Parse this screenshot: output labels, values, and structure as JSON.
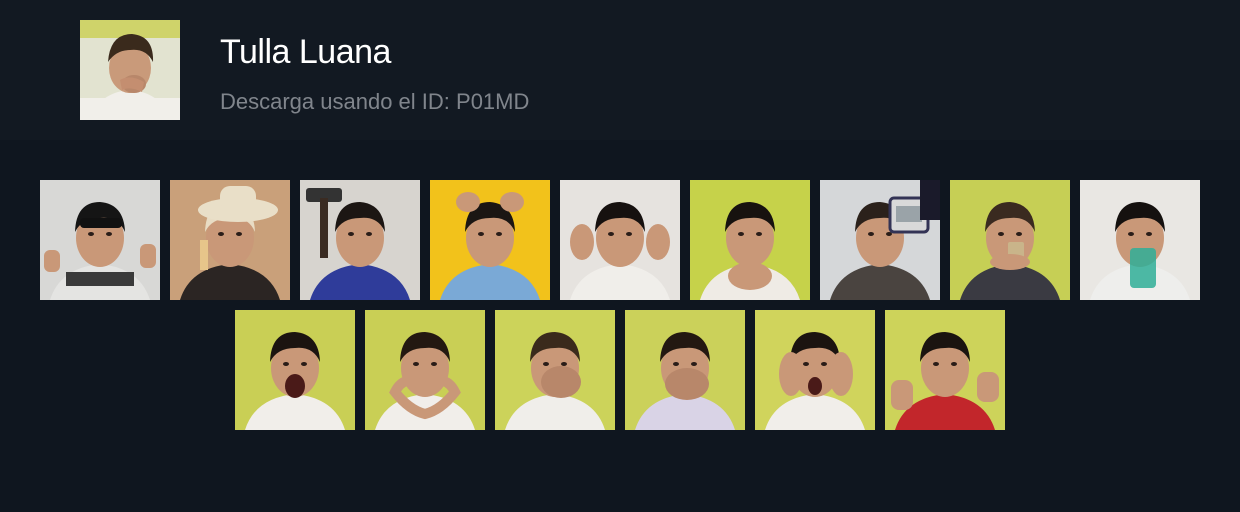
{
  "header": {
    "title": "Tulla Luana",
    "subtitle": "Descarga usando el ID: P01MD"
  },
  "colors": {
    "header_bg": "#121922",
    "page_bg": "#0f161f",
    "title": "#ffffff",
    "subtitle": "#80858c"
  },
  "stickers": [
    {
      "name": "sticker-sunglasses-thumbs-up",
      "bg": "#d8d8d6",
      "shirt": "#e4e4e2",
      "hair": "#151515",
      "prop": "sunglasses-thumbs"
    },
    {
      "name": "sticker-cowboy-hat",
      "bg": "#c9a07a",
      "shirt": "#2b2523",
      "hair": "#e8dcc4",
      "prop": "hat"
    },
    {
      "name": "sticker-hammer",
      "bg": "#d7d4cf",
      "shirt": "#2f3c9a",
      "hair": "#1c1613",
      "prop": "hammer"
    },
    {
      "name": "sticker-hands-on-head",
      "bg": "#f2c21b",
      "shirt": "#7aa9d6",
      "hair": "#1b1613",
      "prop": "hands-up"
    },
    {
      "name": "sticker-hands-on-temples",
      "bg": "#e6e3df",
      "shirt": "#f0eeea",
      "hair": "#16110f",
      "prop": "temples"
    },
    {
      "name": "sticker-praying-hands",
      "bg": "#c6d24a",
      "shirt": "#efebe5",
      "hair": "#17120f",
      "prop": "pray"
    },
    {
      "name": "sticker-blood-pressure-monitor",
      "bg": "#d5d7d9",
      "shirt": "#4a4440",
      "hair": "#2b211b",
      "prop": "monitor"
    },
    {
      "name": "sticker-holding-phone",
      "bg": "#c6cf55",
      "shirt": "#3a3a42",
      "hair": "#3a2a20",
      "prop": "phone"
    },
    {
      "name": "sticker-drinking-glass",
      "bg": "#e9e7e3",
      "shirt": "#eeeeec",
      "hair": "#15110f",
      "prop": "glass"
    },
    {
      "name": "sticker-screaming",
      "bg": "#c9cf55",
      "shirt": "#f1eeea",
      "hair": "#1b1410",
      "prop": "scream"
    },
    {
      "name": "sticker-heart-hands",
      "bg": "#c9cf55",
      "shirt": "#f1eeea",
      "hair": "#231811",
      "prop": "heart"
    },
    {
      "name": "sticker-face-palm",
      "bg": "#ccd35a",
      "shirt": "#f0eeea",
      "hair": "#3a2a1c",
      "prop": "palm"
    },
    {
      "name": "sticker-hand-over-mouth",
      "bg": "#cbd15a",
      "shirt": "#d9d3e6",
      "hair": "#231811",
      "prop": "mouth"
    },
    {
      "name": "sticker-hands-on-cheeks-crying",
      "bg": "#d0d45c",
      "shirt": "#f1eeea",
      "hair": "#1b1410",
      "prop": "cheeks"
    },
    {
      "name": "sticker-double-thumbs-up",
      "bg": "#cdd35a",
      "shirt": "#c2262b",
      "hair": "#1a1410",
      "prop": "thumbs"
    }
  ]
}
